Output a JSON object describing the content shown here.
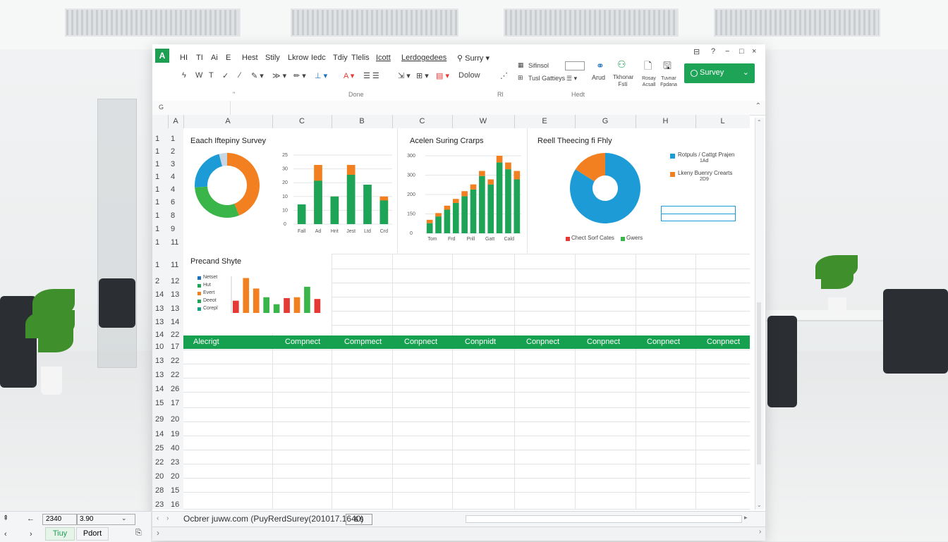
{
  "ribbon": {
    "app_icon": "A",
    "menu": [
      "HI",
      "TI",
      "Ai",
      "E",
      "Hest",
      "Stily",
      "Lkrow",
      "Iedc",
      "Tdiy",
      "Tlelis",
      "Icott",
      "Lerdogedees",
      "Surry"
    ],
    "row2_text": "Dolow",
    "section_labels": [
      "Done",
      "Rl",
      "Hedt"
    ],
    "right_group": {
      "line1": "Sifinsol",
      "line2": "Tusl Gattieys",
      "arud": "Arud",
      "icon_label": "Tkhonar Fsti",
      "btn1": "Rosay Acsall",
      "btn2": "Tuvnar Fpdana"
    },
    "survey_button": "Survey",
    "window_controls": [
      "⊟",
      "?",
      "−",
      "×"
    ]
  },
  "formula_bar": {
    "name_box": "G"
  },
  "columns": [
    "A",
    "A",
    "C",
    "B",
    "C",
    "W",
    "E",
    "G",
    "H",
    "L"
  ],
  "row_numbers_outer": [
    "1",
    "1",
    "1",
    "1",
    "1",
    "1",
    "1",
    "1",
    "1",
    "",
    "1",
    "2",
    "14",
    "13",
    "13",
    "14",
    "10",
    "13",
    "13",
    "14",
    "15",
    "29",
    "14",
    "25",
    "22",
    "20",
    "28",
    "23"
  ],
  "row_numbers_inner": [
    "1",
    "2",
    "3",
    "4",
    "4",
    "6",
    "8",
    "9",
    "11",
    "",
    "11",
    "12",
    "13",
    "13",
    "14",
    "22",
    "17",
    "22",
    "22",
    "26",
    "17",
    "20",
    "19",
    "40",
    "23",
    "20",
    "15",
    "16"
  ],
  "charts": {
    "donut_title": "Eaach Iftepiny Survey",
    "bar1_title": "Acelen Suring Crarps",
    "pie_title": "Reell Theecing fi Fhly",
    "small_title": "Precand Shyte",
    "pie_legend": [
      {
        "label": "Rotpuls / Cattgt Prajen",
        "sub": "1Ad",
        "color": "#1d9bd7"
      },
      {
        "label": "Lkeny Buenry Crearts",
        "sub": "2D9",
        "color": "#f28021"
      }
    ],
    "pie_footer": [
      "Chect Sorf Cates",
      "Gwers"
    ],
    "small_legend": [
      "Netset",
      "Hut",
      "Evert",
      "Deeot",
      "Corepl"
    ]
  },
  "chart_data": [
    {
      "type": "pie",
      "title": "Eaach Iftepiny Survey",
      "values": [
        44,
        30,
        22,
        4
      ],
      "colors": [
        "#f28021",
        "#3ab549",
        "#1d9bd7",
        "#c9d6e3"
      ]
    },
    {
      "type": "bar",
      "title": "",
      "categories": [
        "Fall",
        "Ad",
        "Hrit",
        "Jest",
        "Ltd",
        "Crd"
      ],
      "ylabels": [
        "25",
        "30",
        "20",
        "10",
        "10",
        "0"
      ],
      "series": [
        {
          "values": [
            10,
            22,
            14,
            25,
            20,
            12
          ],
          "color": "#1ea456"
        },
        {
          "values": [
            0,
            30,
            14,
            30,
            0,
            14
          ],
          "color": "#f28021"
        }
      ]
    },
    {
      "type": "bar",
      "title": "Acelen Suring Crarps",
      "categories": [
        "Tom",
        "Frd",
        "Prill",
        "Gatt",
        "Cald"
      ],
      "ylabels": [
        "300",
        "300",
        "200",
        "150",
        "0"
      ],
      "series": [
        {
          "values": [
            30,
            50,
            70,
            90,
            110,
            130,
            170,
            145,
            210,
            190,
            160
          ],
          "color": "#1ea456"
        },
        {
          "values": [
            10,
            10,
            12,
            12,
            15,
            15,
            15,
            15,
            20,
            20,
            25
          ],
          "color": "#f28021"
        }
      ]
    },
    {
      "type": "pie",
      "title": "Reell Theecing fi Fhly",
      "values": [
        84,
        16
      ],
      "colors": [
        "#1d9bd7",
        "#f28021"
      ]
    },
    {
      "type": "bar",
      "title": "Precand Shyte",
      "values": [
        14,
        40,
        28,
        18,
        10,
        17,
        18,
        30,
        16
      ],
      "colors": [
        "#e53935",
        "#f28021",
        "#f28021",
        "#3ab549",
        "#3ab549",
        "#e53935",
        "#f28021",
        "#3ab549",
        "#e53935"
      ]
    }
  ],
  "header_row": [
    "Alecrigt",
    "Compnect",
    "Compmect",
    "Conpnect",
    "Conpnidt",
    "Conpnect",
    "Conpnect",
    "Conpnect",
    "Conpnect"
  ],
  "status": {
    "left1": "2340",
    "left2": "3.90",
    "path": "Ocbrer juww.com (PuyRerdSurey(201017.1640)",
    "badge": "5 5"
  },
  "tabs": [
    "Tiuy",
    "Pdort"
  ]
}
